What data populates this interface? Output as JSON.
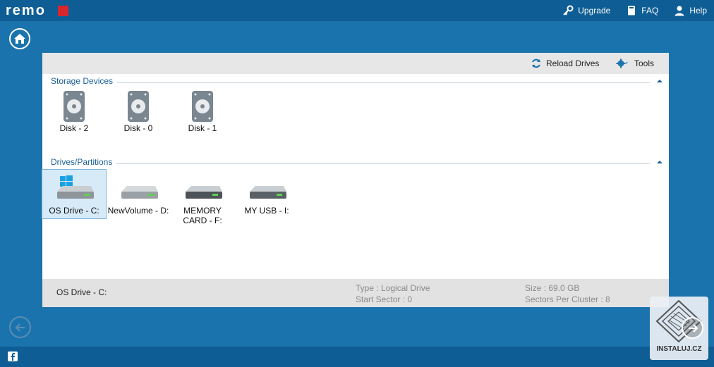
{
  "app": {
    "logo_text": "remo"
  },
  "top_links": [
    {
      "label": "Upgrade",
      "icon": "key-icon"
    },
    {
      "label": "FAQ",
      "icon": "book-icon"
    },
    {
      "label": "Help",
      "icon": "user-icon"
    }
  ],
  "toolbar": {
    "reload_label": "Reload Drives",
    "tools_label": "Tools"
  },
  "storage": {
    "title": "Storage Devices",
    "devices": [
      {
        "label": "Disk - 2"
      },
      {
        "label": "Disk - 0"
      },
      {
        "label": "Disk - 1"
      }
    ]
  },
  "partitions": {
    "title": "Drives/Partitions",
    "drives": [
      {
        "label": "OS Drive - C:",
        "selected": true
      },
      {
        "label": "NewVolume - D:"
      },
      {
        "label": "MEMORY CARD - F:"
      },
      {
        "label": "MY USB - I:"
      }
    ]
  },
  "status": {
    "name": "OS Drive - C:",
    "type": "Type : Logical Drive",
    "start_sector": "Start Sector : 0",
    "size": "Size : 69.0 GB",
    "sectors_per_cluster": "Sectors Per Cluster : 8"
  },
  "watermark": {
    "text": "INSTALUJ.CZ"
  },
  "colors": {
    "accent": "#1a73ad",
    "dark": "#0e5e95",
    "section_title": "#1a5f9a",
    "logo_red": "#d7262d"
  }
}
